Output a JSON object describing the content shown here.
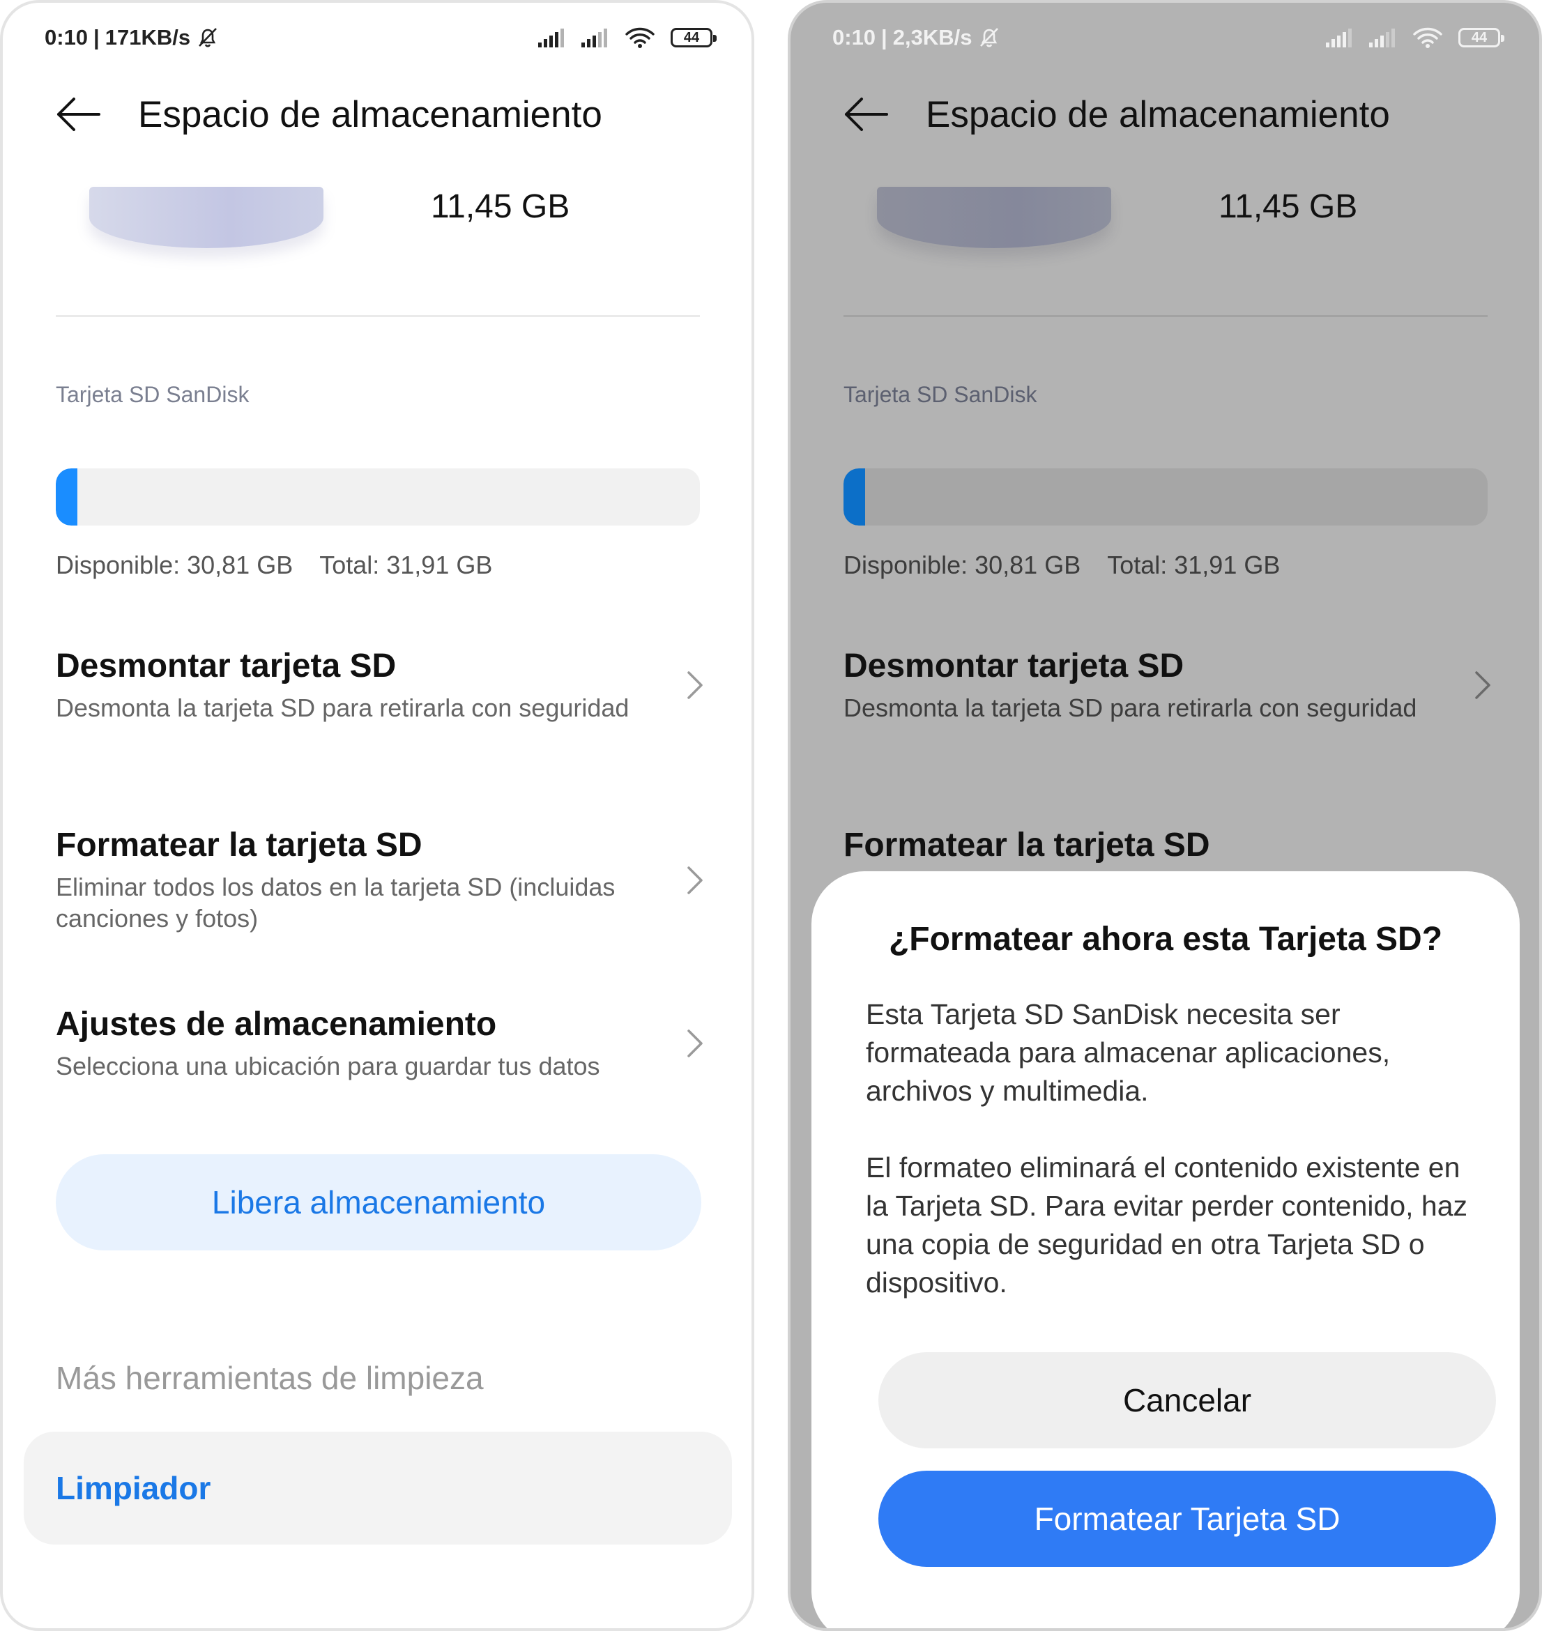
{
  "left_screen": {
    "status": {
      "time": "0:10",
      "speed": "171KB/s",
      "battery": "44"
    },
    "header": {
      "title": "Espacio de almacenamiento"
    },
    "usage": {
      "used": "11,45 GB",
      "used_fraction": 0.034
    },
    "sd": {
      "label": "Tarjeta SD SanDisk",
      "available": "Disponible: 30,81 GB",
      "total": "Total: 31,91 GB"
    },
    "options": [
      {
        "title": "Desmontar tarjeta SD",
        "description": "Desmonta la tarjeta SD para retirarla con seguridad"
      },
      {
        "title": "Formatear la tarjeta SD",
        "description": "Eliminar todos los datos en la tarjeta SD (incluidas canciones y fotos)"
      },
      {
        "title": "Ajustes de almacenamiento",
        "description": "Selecciona una ubicación para guardar tus datos"
      }
    ],
    "free_button": "Libera almacenamiento",
    "more_tools": "Más herramientas de limpieza",
    "cleaner": "Limpiador"
  },
  "right_screen": {
    "status": {
      "time": "0:10",
      "speed": "2,3KB/s",
      "battery": "44"
    },
    "header": {
      "title": "Espacio de almacenamiento"
    },
    "usage": {
      "used": "11,45 GB",
      "used_fraction": 0.034
    },
    "sd": {
      "label": "Tarjeta SD SanDisk",
      "available": "Disponible: 30,81 GB",
      "total": "Total: 31,91 GB"
    },
    "options": [
      {
        "title": "Desmontar tarjeta SD",
        "description": "Desmonta la tarjeta SD para retirarla con seguridad"
      },
      {
        "title": "Formatear la tarjeta SD"
      }
    ],
    "dialog": {
      "title": "¿Formatear ahora esta Tarjeta SD?",
      "paragraph1": "Esta Tarjeta SD SanDisk necesita ser formateada para almacenar aplicaciones, archivos y multimedia.",
      "paragraph2": "El formateo eliminará el contenido existente en la Tarjeta SD. Para evitar perder contenido, haz una copia de seguridad en otra Tarjeta SD o dispositivo.",
      "cancel": "Cancelar",
      "confirm": "Formatear Tarjeta SD"
    }
  },
  "icons": [
    "back-arrow-icon",
    "mute-bell-icon",
    "signal-icon",
    "wifi-icon",
    "battery-icon",
    "chevron-right-icon"
  ],
  "colors": {
    "accent": "#1a78e6",
    "progress": "#1a8dff",
    "dialog_button": "#2f7bf5",
    "scrim": "#b3b3b3"
  }
}
